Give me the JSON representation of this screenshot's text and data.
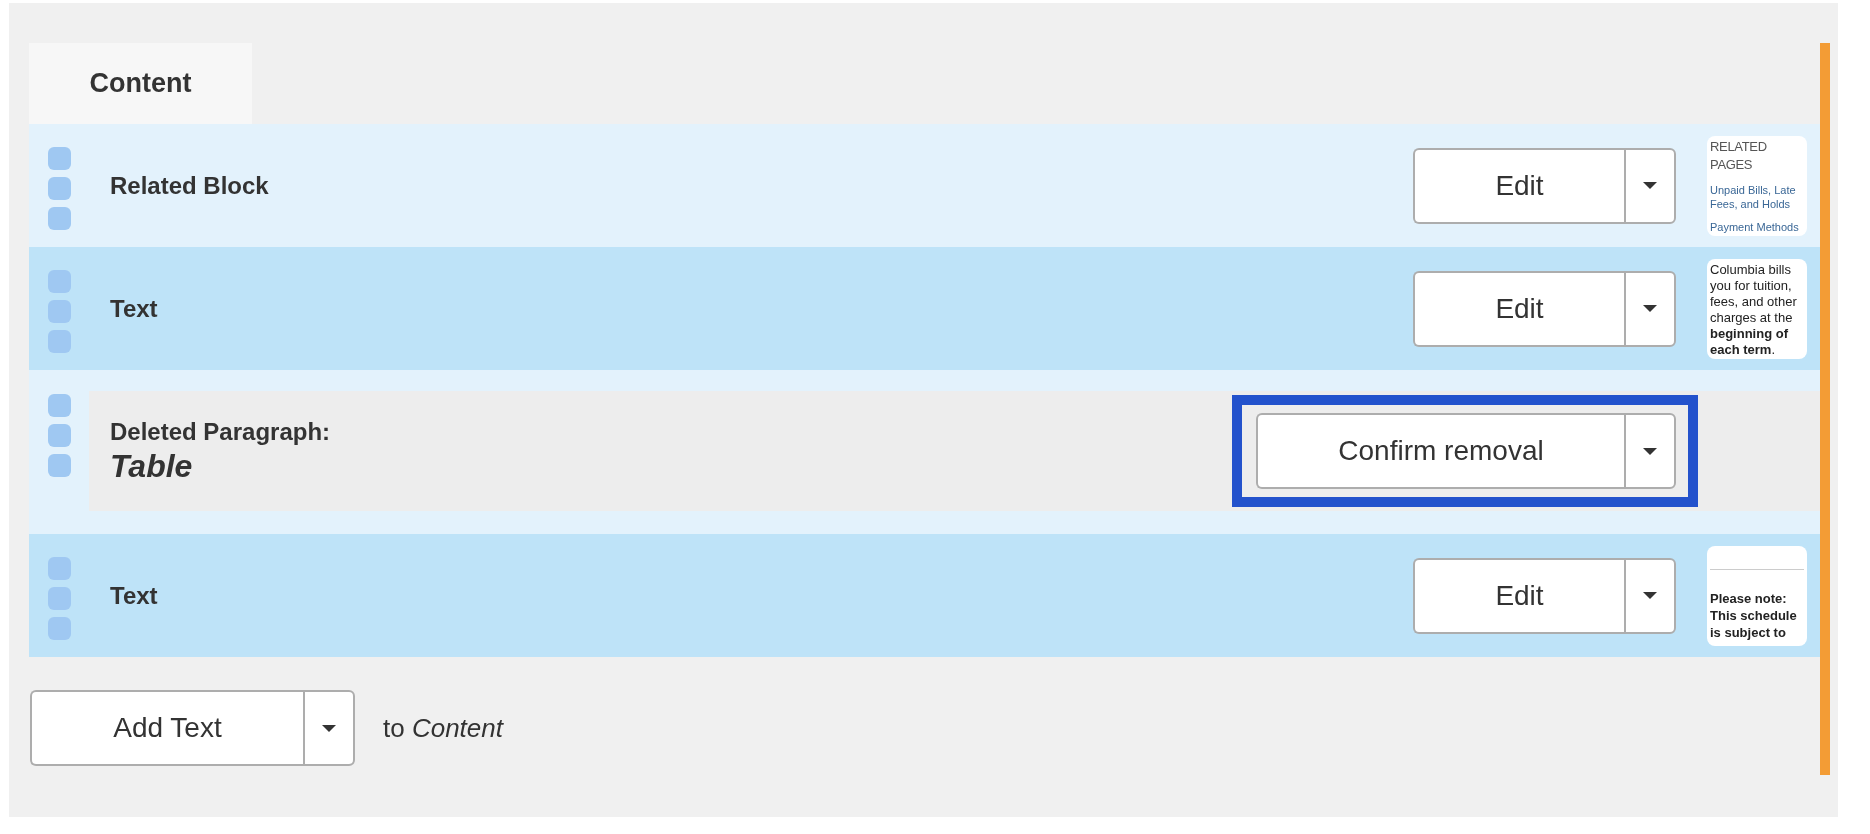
{
  "region": {
    "title": "Content"
  },
  "blocks": [
    {
      "kind": "block",
      "label": "Related Block",
      "action": {
        "label": "Edit",
        "highlighted": false
      },
      "preview": {
        "kind": "links",
        "heading": "RELATED PAGES",
        "links": [
          "Unpaid Bills, Late Fees, and Holds",
          "Payment Methods"
        ]
      }
    },
    {
      "kind": "block",
      "label": "Text",
      "action": {
        "label": "Edit",
        "highlighted": false
      },
      "preview": {
        "kind": "text",
        "text": "Columbia bills you for tuition, fees, and other charges at the **beginning of each term**."
      }
    },
    {
      "kind": "deleted",
      "label": "Deleted Paragraph:",
      "block_type": "Table",
      "action": {
        "label": "Confirm removal",
        "highlighted": true
      }
    },
    {
      "kind": "block",
      "label": "Text",
      "action": {
        "label": "Edit",
        "highlighted": false
      },
      "preview": {
        "kind": "note",
        "text": "Please note: This schedule is subject to"
      }
    }
  ],
  "add": {
    "button": "Add Text",
    "target": "to *Content*"
  }
}
